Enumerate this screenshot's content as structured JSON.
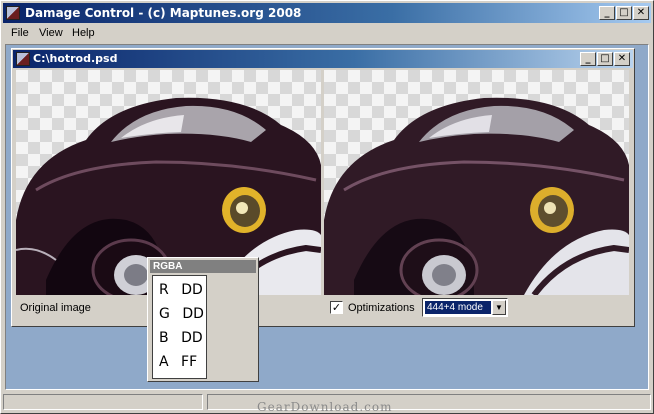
{
  "window": {
    "title": "Damage Control  -  (c) Maptunes.org 2008",
    "minimize_glyph": "_",
    "maximize_glyph": "□",
    "close_glyph": "✕"
  },
  "menu": {
    "items": [
      {
        "label": "File"
      },
      {
        "label": "View"
      },
      {
        "label": "Help"
      }
    ]
  },
  "document": {
    "title": "C:\\hotrod.psd",
    "original_label": "Original image",
    "optimizations_label": "Optimizations",
    "optimizations_checked": "✓",
    "mode_value": "444+4 mode",
    "dropdown_glyph": "▼"
  },
  "rgba_panel": {
    "title": "RGBA",
    "rows": [
      {
        "channel": "R",
        "value": "DD"
      },
      {
        "channel": "G",
        "value": "DD"
      },
      {
        "channel": "B",
        "value": "DD"
      },
      {
        "channel": "A",
        "value": "FF"
      }
    ]
  },
  "watermark": "GearDownload.com",
  "colors": {
    "titlebar": "#0a246a",
    "client_bg": "#8fa9c9",
    "car_body": "#2a1420",
    "headlight_ring": "#e1b32a"
  }
}
